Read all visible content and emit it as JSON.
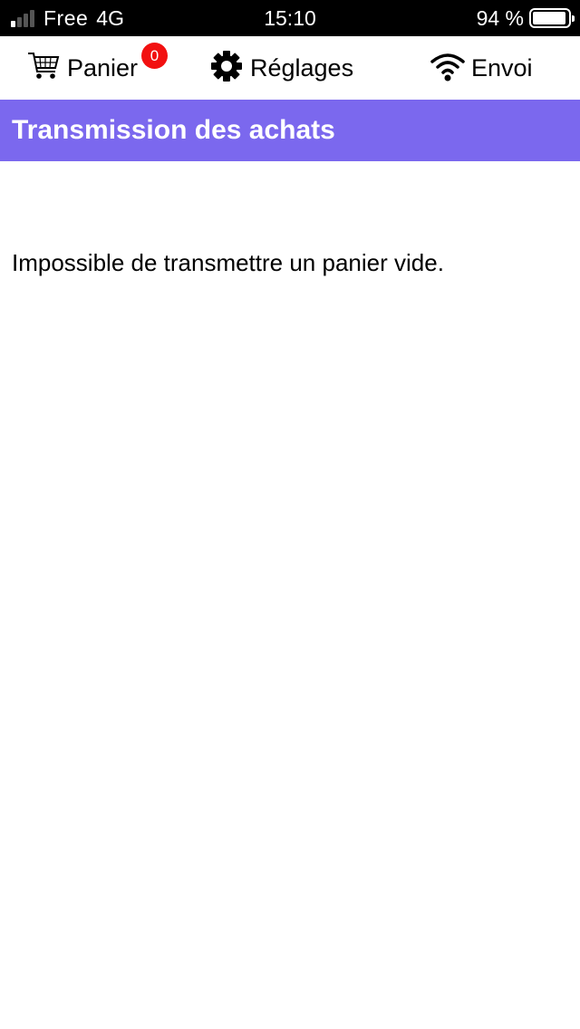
{
  "status_bar": {
    "carrier": "Free",
    "network": "4G",
    "time": "15:10",
    "battery_percent": "94 %",
    "battery_level": 0.94,
    "signal_bars_active": 1,
    "signal_bars_total": 4
  },
  "nav": {
    "items": [
      {
        "label": "Panier",
        "icon": "cart-icon",
        "badge": "0"
      },
      {
        "label": "Réglages",
        "icon": "gear-icon"
      },
      {
        "label": "Envoi",
        "icon": "wifi-icon"
      }
    ]
  },
  "page": {
    "title": "Transmission des achats",
    "message": "Impossible de transmettre un panier vide."
  },
  "colors": {
    "title_bar_bg": "#7b68ee",
    "badge_bg": "#f21010",
    "status_bar_bg": "#000000"
  }
}
